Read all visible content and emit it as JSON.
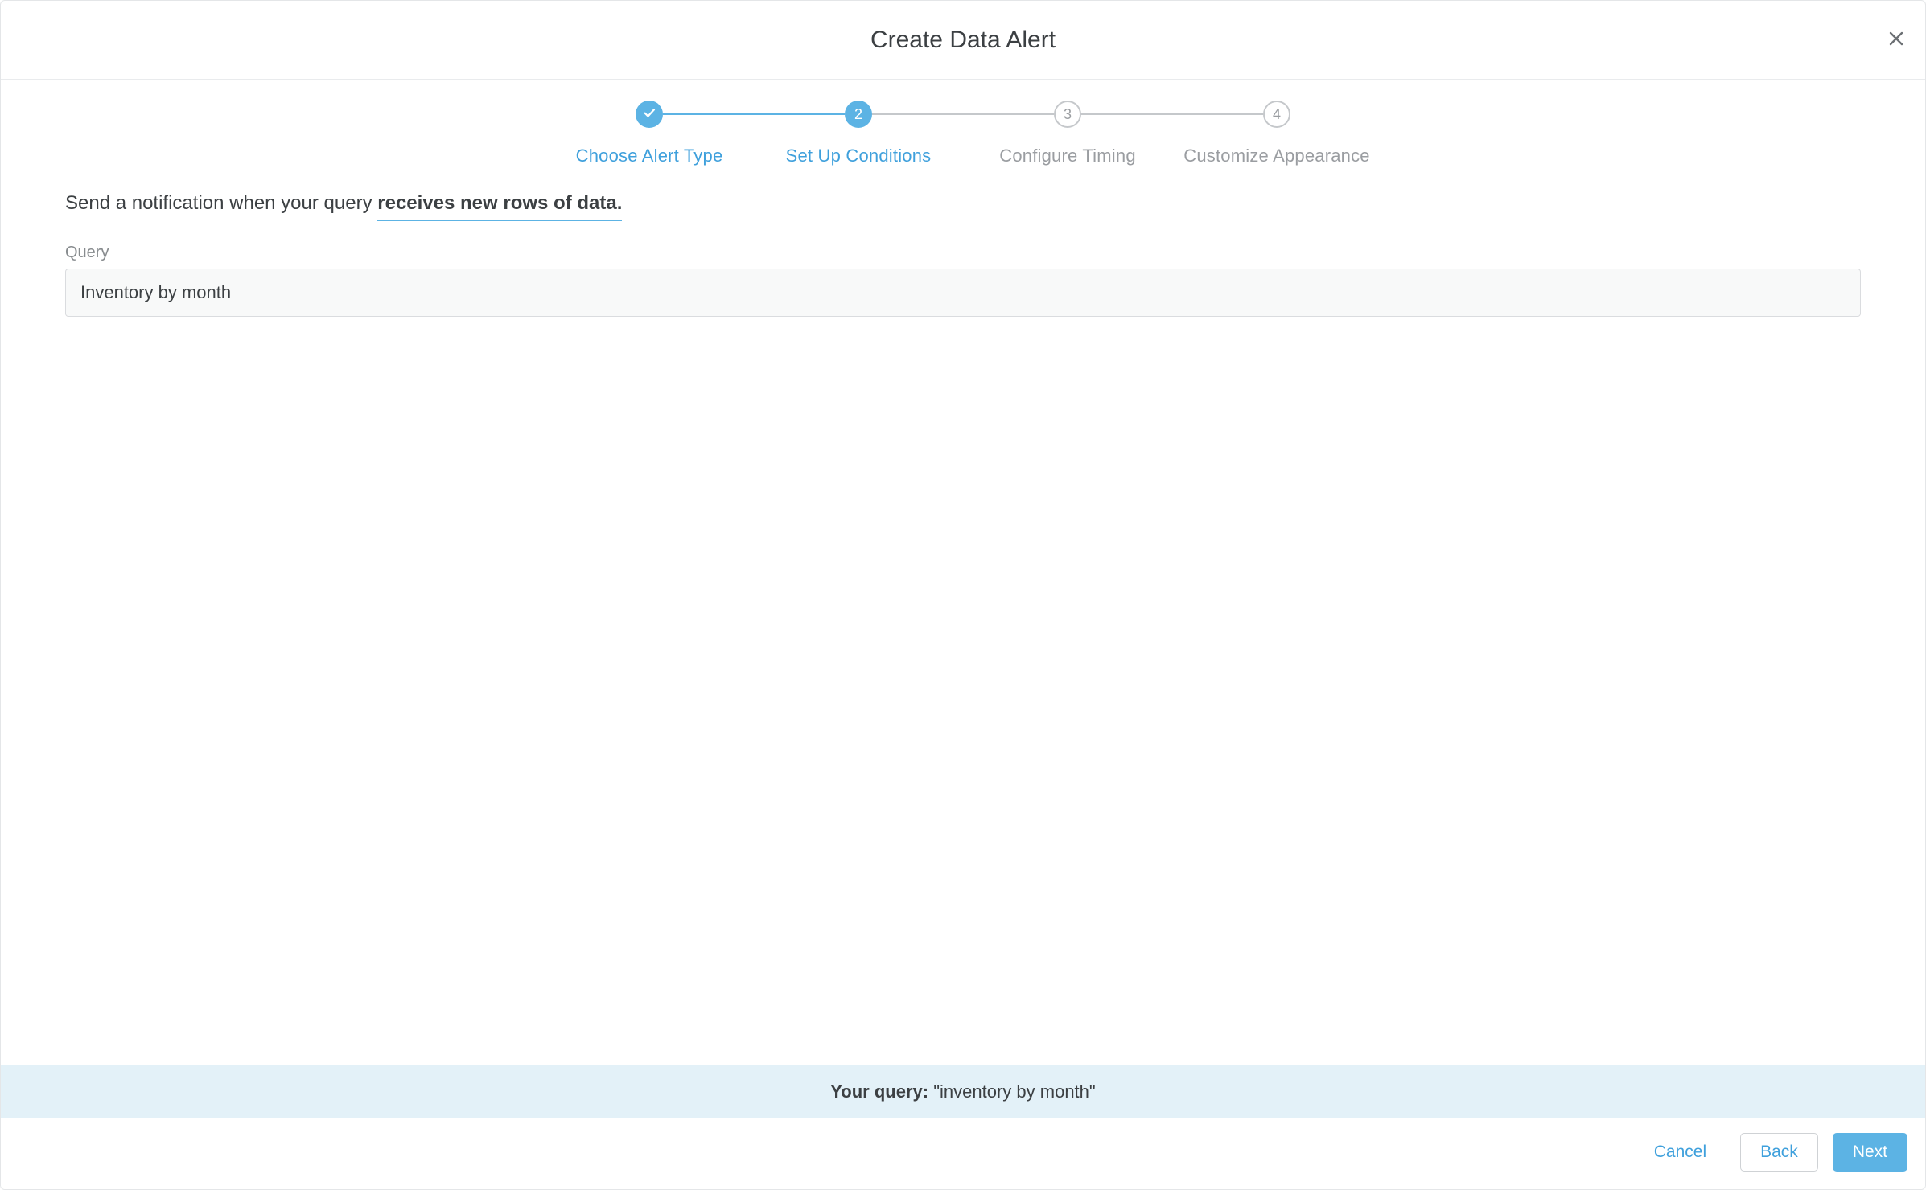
{
  "header": {
    "title": "Create Data Alert",
    "close_icon": "close-icon"
  },
  "stepper": {
    "steps": [
      {
        "label": "Choose Alert Type",
        "state": "done",
        "indicator": "check"
      },
      {
        "label": "Set Up Conditions",
        "state": "current",
        "indicator": "2"
      },
      {
        "label": "Configure Timing",
        "state": "upcoming",
        "indicator": "3"
      },
      {
        "label": "Customize Appearance",
        "state": "upcoming",
        "indicator": "4"
      }
    ]
  },
  "conditions": {
    "sentence_prefix": "Send a notification when your query ",
    "trigger_phrase": "receives new rows of data.",
    "query_label": "Query",
    "query_value": "Inventory by month"
  },
  "summary": {
    "prefix": "Your query: ",
    "query_text": "\"inventory by month\""
  },
  "footer": {
    "cancel": "Cancel",
    "back": "Back",
    "next": "Next"
  },
  "colors": {
    "accent": "#5cb3e4",
    "banner_bg": "#e3f1f8",
    "muted_text": "#9a9da1"
  }
}
